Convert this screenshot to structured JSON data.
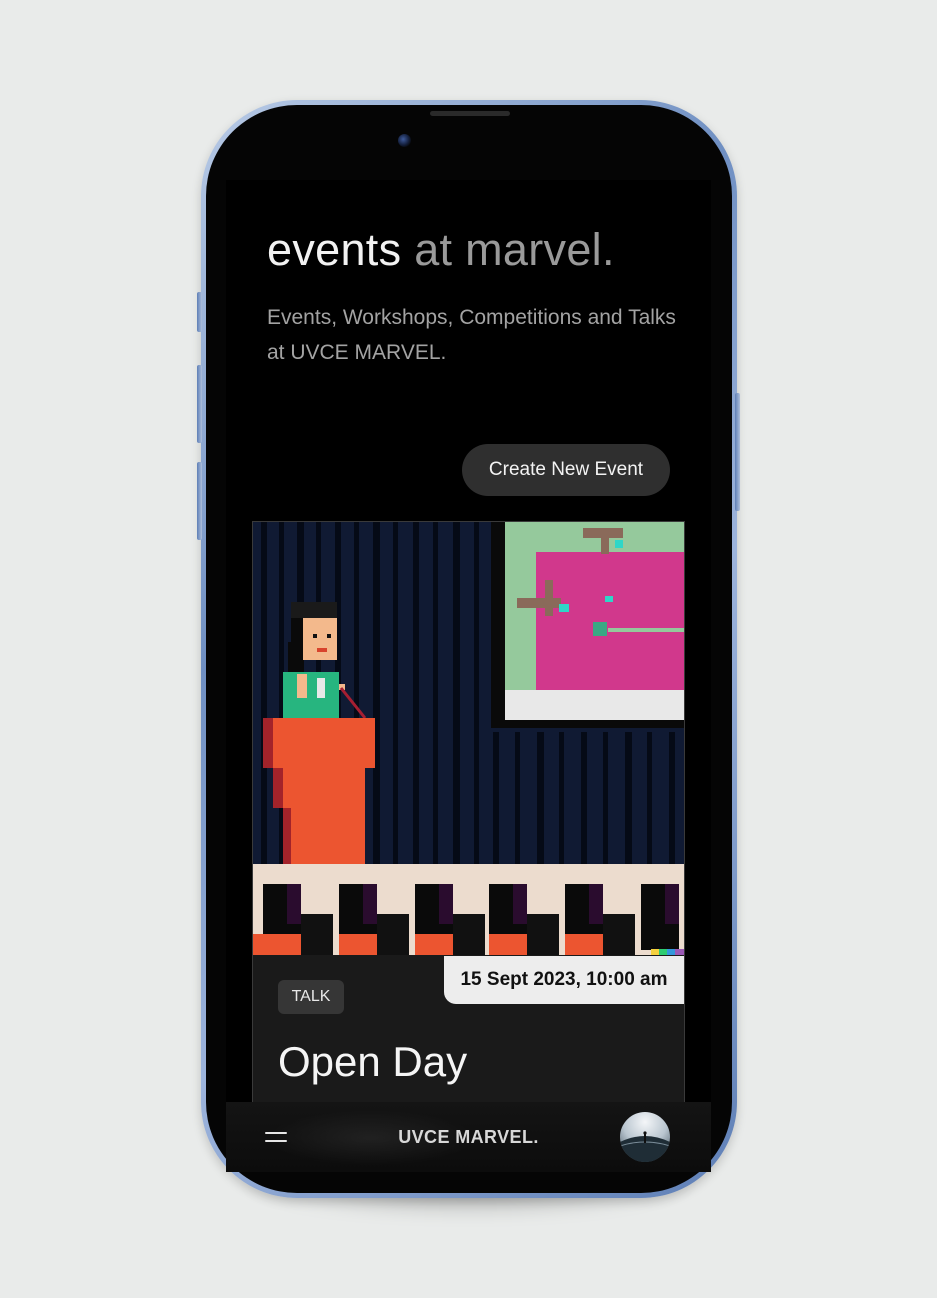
{
  "hero": {
    "title_main": "events",
    "title_muted": " at marvel.",
    "subtitle": "Events, Workshops, Competitions and Talks at UVCE MARVEL."
  },
  "actions": {
    "create_label": "Create New Event"
  },
  "event": {
    "date": "15 Sept 2023, 10:00 am",
    "type": "TALK",
    "title": "Open Day"
  },
  "bottom_nav": {
    "brand": "UVCE MARVEL.",
    "menu_icon": "hamburger-menu-icon",
    "avatar_icon": "profile-avatar"
  },
  "colors": {
    "screen_background": "#000000",
    "card_background": "#1a1a1a",
    "button_background": "#2f2f2f",
    "date_badge_background": "#ededed",
    "muted_text": "#9a9a9a",
    "phone_frame": "#7f9dcc"
  }
}
